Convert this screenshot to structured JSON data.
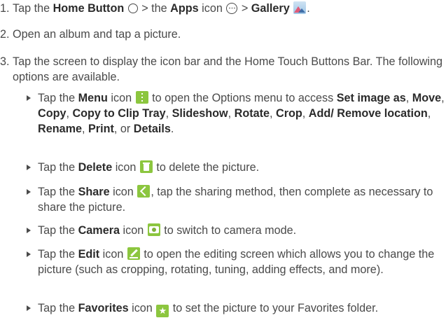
{
  "steps": [
    {
      "num": "1.",
      "t1": "Tap the ",
      "b1": "Home Button",
      "t2": " > the ",
      "b2": "Apps",
      "t3": " icon ",
      "t4": " > ",
      "b3": "Gallery",
      "t5": "."
    },
    {
      "num": "2.",
      "text": "Open an album and tap a picture."
    },
    {
      "num": "3.",
      "text": "Tap the screen to display the icon bar and the Home Touch Buttons Bar. The following options are available."
    }
  ],
  "bullets": {
    "menu": {
      "t1": "Tap the ",
      "b1": "Menu",
      "t2": " icon ",
      "t3": " to open the Options menu to access ",
      "o1": "Set image as",
      "o2": "Move",
      "o3": "Copy",
      "o4": "Copy to Clip Tray",
      "o5": "Slideshow",
      "o6": "Rotate",
      "o7": "Crop",
      "o8": "Add/ Remove location",
      "o9": "Rename",
      "o10": "Print",
      "o11": "Details"
    },
    "delete": {
      "t1": "Tap the ",
      "b1": "Delete",
      "t2": " icon ",
      "t3": " to delete the picture."
    },
    "share": {
      "t1": "Tap the ",
      "b1": "Share",
      "t2": " icon ",
      "t3": ", tap the sharing method, then complete as necessary to share the picture."
    },
    "camera": {
      "t1": "Tap the ",
      "b1": "Camera",
      "t2": " icon ",
      "t3": " to switch to camera mode."
    },
    "edit": {
      "t1": "Tap the ",
      "b1": "Edit",
      "t2": " icon ",
      "t3": " to open the editing screen which allows you to change the picture (such as cropping, rotating, tuning, adding effects, and more)."
    },
    "favorites": {
      "t1": "Tap the ",
      "b1": "Favorites",
      "t2": " icon ",
      "t3": " to set the picture to your Favorites folder.",
      "star": "★"
    }
  },
  "icons": [
    "home-button-icon",
    "apps-icon",
    "gallery-icon",
    "menu-icon",
    "delete-icon",
    "share-icon",
    "camera-icon",
    "edit-icon",
    "favorites-icon"
  ],
  "colors": {
    "text": "#4a4a4a",
    "icon_green": "#8cc63f"
  }
}
